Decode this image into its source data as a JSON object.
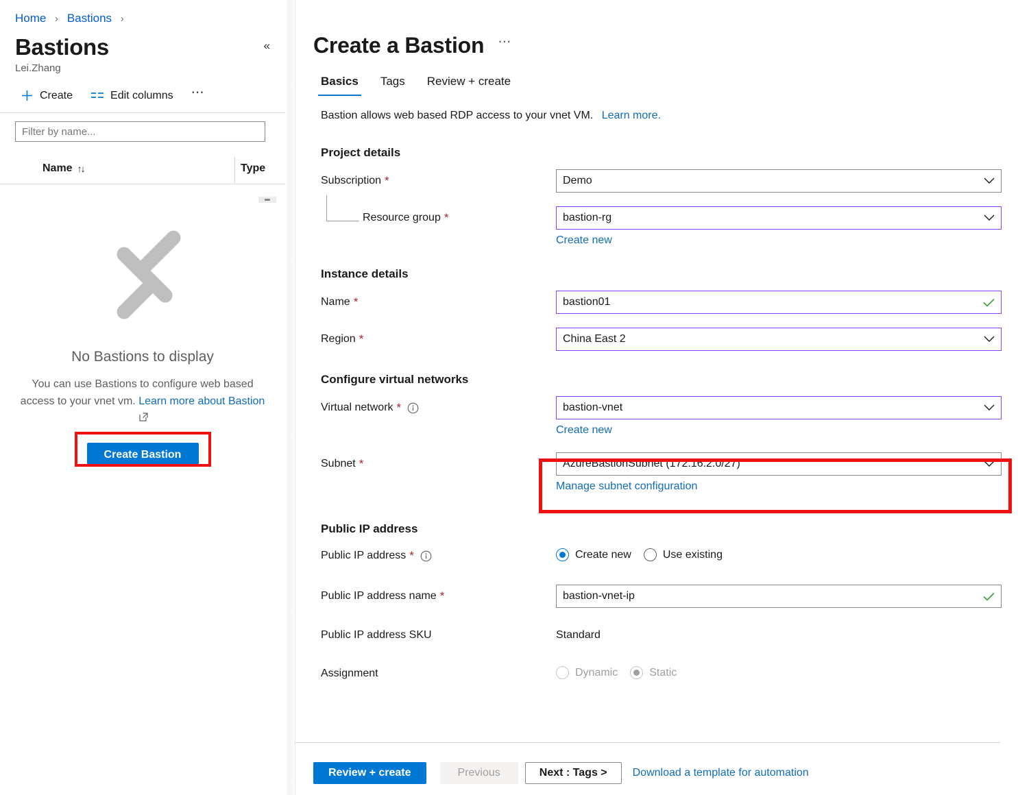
{
  "breadcrumb": {
    "items": [
      "Home",
      "Bastions"
    ],
    "separator": "›"
  },
  "left_panel": {
    "title": "Bastions",
    "subtitle": "Lei.Zhang",
    "collapse_icon": "«",
    "toolbar": {
      "create_label": "Create",
      "edit_columns_label": "Edit columns",
      "more_label": "⋯"
    },
    "filter": {
      "placeholder": "Filter by name...",
      "value": ""
    },
    "grid": {
      "columns": [
        "Name",
        "Type"
      ],
      "sort_indicator": "↑↓"
    },
    "empty_state": {
      "title": "No Bastions to display",
      "description": "You can use Bastions to configure web based access to your vnet vm.",
      "link_text": "Learn more about Bastion",
      "button_label": "Create Bastion"
    }
  },
  "right_panel": {
    "title": "Create a Bastion",
    "more_label": "⋯",
    "tabs": [
      {
        "label": "Basics",
        "active": true
      },
      {
        "label": "Tags",
        "active": false
      },
      {
        "label": "Review + create",
        "active": false
      }
    ],
    "intro": {
      "text": "Bastion allows web based RDP access to your vnet VM.",
      "link": "Learn more."
    },
    "sections": {
      "project_details": {
        "title": "Project details",
        "subscription": {
          "label": "Subscription",
          "required": "*",
          "value": "Demo"
        },
        "resource_group": {
          "label": "Resource group",
          "required": "*",
          "value": "bastion-rg",
          "create_new": "Create new"
        }
      },
      "instance_details": {
        "title": "Instance details",
        "name": {
          "label": "Name",
          "required": "*",
          "value": "bastion01"
        },
        "region": {
          "label": "Region",
          "required": "*",
          "value": "China East 2"
        }
      },
      "virtual_networks": {
        "title": "Configure virtual networks",
        "virtual_network": {
          "label": "Virtual network",
          "required": "*",
          "value": "bastion-vnet",
          "create_new": "Create new"
        },
        "subnet": {
          "label": "Subnet",
          "required": "*",
          "value": "AzureBastionSubnet (172.16.2.0/27)",
          "manage_link": "Manage subnet configuration"
        }
      },
      "public_ip": {
        "title": "Public IP address",
        "public_ip_address": {
          "label": "Public IP address",
          "required": "*",
          "options": [
            "Create new",
            "Use existing"
          ],
          "selected": "Create new"
        },
        "public_ip_name": {
          "label": "Public IP address name",
          "required": "*",
          "value": "bastion-vnet-ip"
        },
        "public_ip_sku": {
          "label": "Public IP address SKU",
          "value": "Standard"
        },
        "assignment": {
          "label": "Assignment",
          "options": [
            "Dynamic",
            "Static"
          ],
          "selected": "Static",
          "disabled": true
        }
      }
    },
    "footer": {
      "review_create": "Review + create",
      "previous": "Previous",
      "next": "Next : Tags >",
      "download_template": "Download a template for automation"
    }
  },
  "colors": {
    "accent_blue": "#0078d4",
    "link_blue": "#0f6cbd",
    "highlight_red": "#ee1111",
    "modified_purple": "#8a3ffc",
    "valid_green": "#3a9e3a",
    "required_red": "#a4262c"
  }
}
